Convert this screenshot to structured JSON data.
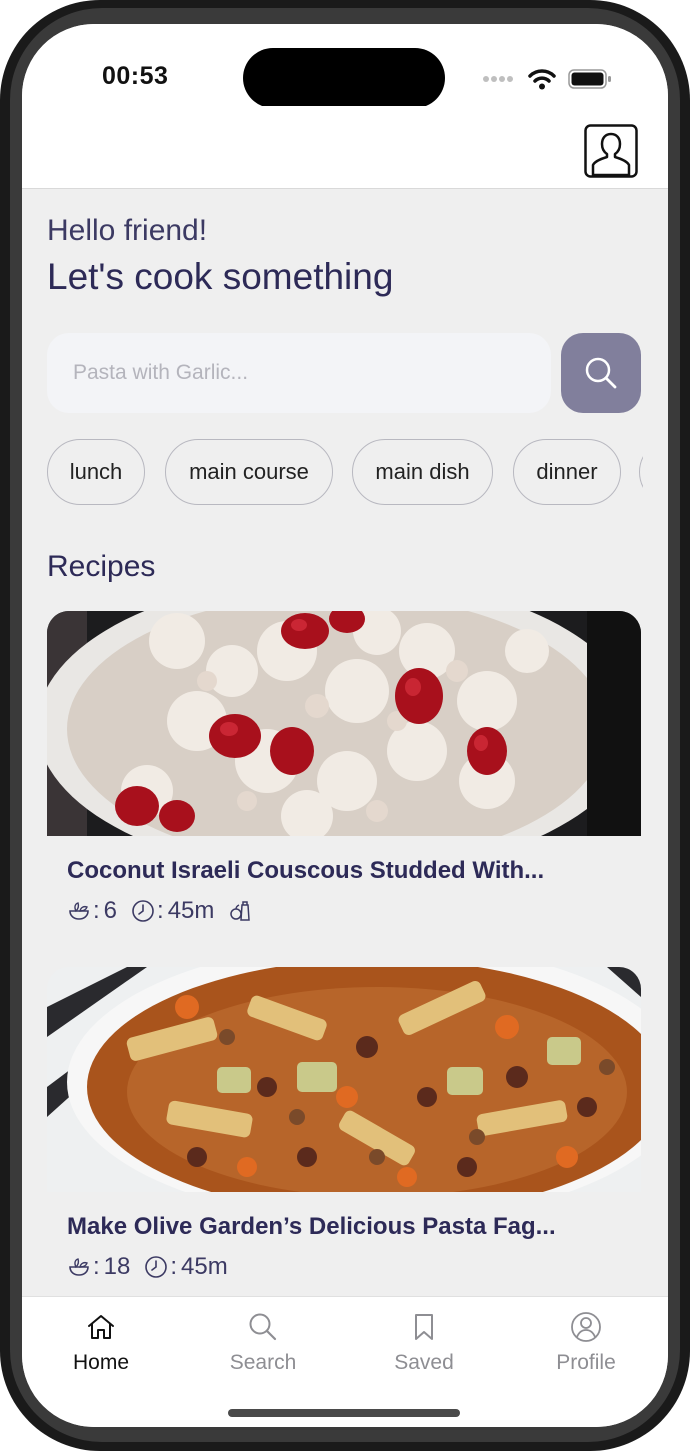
{
  "status_bar": {
    "time": "00:53"
  },
  "home": {
    "greeting": "Hello friend!",
    "headline": "Let's cook something",
    "search": {
      "placeholder": "Pasta with Garlic..."
    },
    "tags": [
      "lunch",
      "main course",
      "main dish",
      "dinner"
    ],
    "section_title": "Recipes"
  },
  "recipes": [
    {
      "title": "Coconut Israeli Couscous Studded With...",
      "servings": "6",
      "time": "45m"
    },
    {
      "title": "Make Olive Garden’s Delicious Pasta Fag...",
      "servings": "18",
      "time": "45m"
    }
  ],
  "meta_separator": ":",
  "tab_bar": {
    "items": [
      {
        "label": "Home",
        "icon": "home-icon",
        "active": true
      },
      {
        "label": "Search",
        "icon": "search-icon",
        "active": false
      },
      {
        "label": "Saved",
        "icon": "bookmark-icon",
        "active": false
      },
      {
        "label": "Profile",
        "icon": "profile-icon",
        "active": false
      }
    ]
  },
  "colors": {
    "accent_dark": "#2d2a57",
    "search_button": "#817f9c",
    "tab_active": "#111111",
    "tab_inactive": "#8e8e93"
  }
}
